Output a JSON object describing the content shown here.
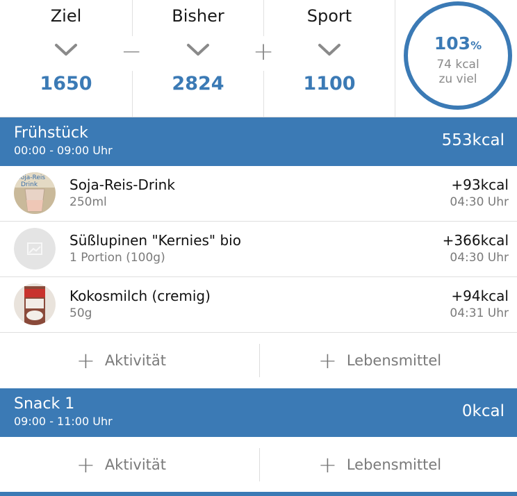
{
  "summary": {
    "goal": {
      "label": "Ziel",
      "value": "1650"
    },
    "so_far": {
      "label": "Bisher",
      "value": "2824"
    },
    "sport": {
      "label": "Sport",
      "value": "1100"
    },
    "op_minus": "−",
    "op_plus": "+",
    "ring": {
      "percent": "103",
      "percent_sign": "%",
      "line1": "74 kcal",
      "line2": "zu viel",
      "color": "#3b7ab5"
    }
  },
  "meals": [
    {
      "name": "Frühstück",
      "time": "00:00 - 09:00 Uhr",
      "kcal": "553kcal",
      "items": [
        {
          "name": "Soja-Reis-Drink",
          "amount": "250ml",
          "kcal": "+93kcal",
          "time": "04:30 Uhr",
          "image": "soy-rice-drink-photo"
        },
        {
          "name": "Süßlupinen \"Kernies\" bio",
          "amount": "1 Portion (100g)",
          "kcal": "+366kcal",
          "time": "04:30 Uhr",
          "image": "placeholder-image-icon"
        },
        {
          "name": "Kokosmilch (cremig)",
          "amount": "50g",
          "kcal": "+94kcal",
          "time": "04:31 Uhr",
          "image": "coconut-milk-can-photo"
        }
      ],
      "actions": {
        "activity": "Aktivität",
        "food": "Lebensmittel"
      }
    },
    {
      "name": "Snack 1",
      "time": "09:00 - 11:00 Uhr",
      "kcal": "0kcal",
      "items": [],
      "actions": {
        "activity": "Aktivität",
        "food": "Lebensmittel"
      }
    }
  ],
  "colors": {
    "accent": "#3b7ab5",
    "muted": "#7a7a7a"
  }
}
